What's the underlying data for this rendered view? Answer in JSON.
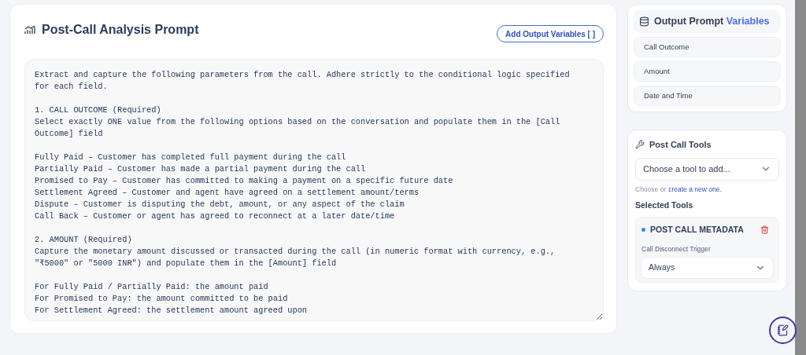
{
  "prompt_card": {
    "title": "Post-Call Analysis Prompt",
    "add_button": "Add Output Variables [ ]",
    "prompt_value": "Extract and capture the following parameters from the call. Adhere strictly to the conditional logic specified for each field.\n\n1. CALL OUTCOME (Required)\nSelect exactly ONE value from the following options based on the conversation and populate them in the [Call Outcome] field\n\nFully Paid – Customer has completed full payment during the call\nPartially Paid – Customer has made a partial payment during the call\nPromised to Pay – Customer has committed to making a payment on a specific future date\nSettlement Agreed – Customer and agent have agreed on a settlement amount/terms\nDispute – Customer is disputing the debt, amount, or any aspect of the claim\nCall Back – Customer or agent has agreed to reconnect at a later date/time\n\n2. AMOUNT (Required)\nCapture the monetary amount discussed or transacted during the call (in numeric format with currency, e.g., \"₹5000\" or \"5000 INR\") and populate them in the [Amount] field\n\nFor Fully Paid / Partially Paid: the amount paid\nFor Promised to Pay: the amount committed to be paid\nFor Settlement Agreed: the settlement amount agreed upon"
  },
  "variables_panel": {
    "title": "Output Prompt",
    "title_highlight": "Variables",
    "items": [
      "Call Outcome",
      "Amount",
      "Date and Time"
    ]
  },
  "tools_panel": {
    "title": "Post Call Tools",
    "select_placeholder": "Choose a tool to add...",
    "hint": "Choose or",
    "hint_link": "create a new one.",
    "selected_heading": "Selected Tools",
    "selected_tools": [
      {
        "name": "POST CALL METADATA",
        "color": "#3b82f6",
        "field_label": "Call Disconnect Trigger",
        "field_value": "Always"
      }
    ]
  }
}
